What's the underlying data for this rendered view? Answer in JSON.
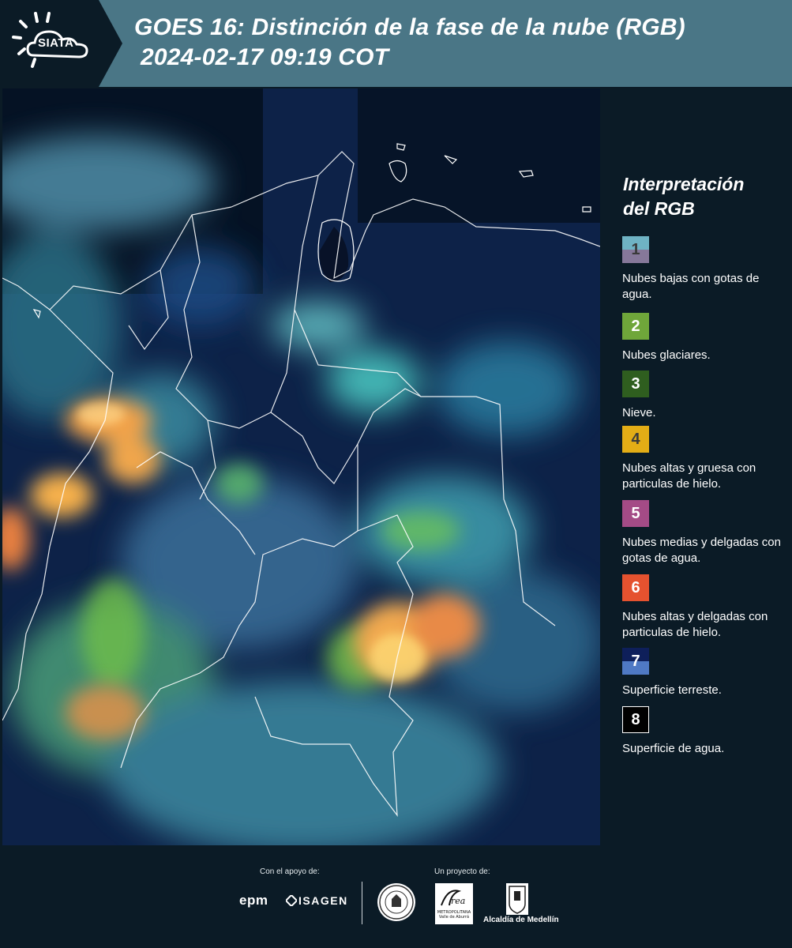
{
  "header": {
    "logo_text": "SIATA",
    "title_line1": "GOES 16: Distinción de la fase de la nube (RGB)",
    "title_line2": "2024-02-17 09:19 COT"
  },
  "legend": {
    "title_line1": "Interpretación",
    "title_line2": "del RGB",
    "items": [
      {
        "num": "1",
        "label": "Nubes bajas con gotas de agua.",
        "color_top": "#6fb3c4",
        "color_bottom": "#86789a",
        "num_color": "#3a3a3a"
      },
      {
        "num": "2",
        "label": "Nubes glaciares.",
        "color_top": "#6fa63a",
        "color_bottom": "#6fa63a",
        "num_color": "#ffffff"
      },
      {
        "num": "3",
        "label": "Nieve.",
        "color_top": "#2f5e1f",
        "color_bottom": "#2f5e1f",
        "num_color": "#ffffff"
      },
      {
        "num": "4",
        "label": "Nubes altas y gruesa con particulas de hielo.",
        "color_top": "#e3ad16",
        "color_bottom": "#e3ad16",
        "num_color": "#3a3a3a"
      },
      {
        "num": "5",
        "label": "Nubes medias y delgadas con gotas de agua.",
        "color_top": "#a44b86",
        "color_bottom": "#a44b86",
        "num_color": "#ffffff"
      },
      {
        "num": "6",
        "label": "Nubes altas y delgadas con particulas de hielo.",
        "color_top": "#e5522f",
        "color_bottom": "#e5522f",
        "num_color": "#ffffff"
      },
      {
        "num": "7",
        "label": "Superficie terreste.",
        "color_top": "#0e1f5a",
        "color_bottom": "#4f79c4",
        "num_color": "#ffffff"
      },
      {
        "num": "8",
        "label": "Superficie de agua.",
        "color_top": "#000000",
        "color_bottom": "#000000",
        "num_color": "#ffffff",
        "border": "#ffffff"
      }
    ]
  },
  "footer": {
    "support_label": "Con el apoyo de:",
    "project_label": "Un proyecto de:",
    "epm": "epm",
    "isagen": "ISAGEN",
    "area_text": "METROPOLITANA Valle de Aburrá",
    "alcaldia": "Alcaldía de Medellín"
  },
  "colors": {
    "header_bg": "#4a7686",
    "page_bg": "#0b1b26"
  }
}
